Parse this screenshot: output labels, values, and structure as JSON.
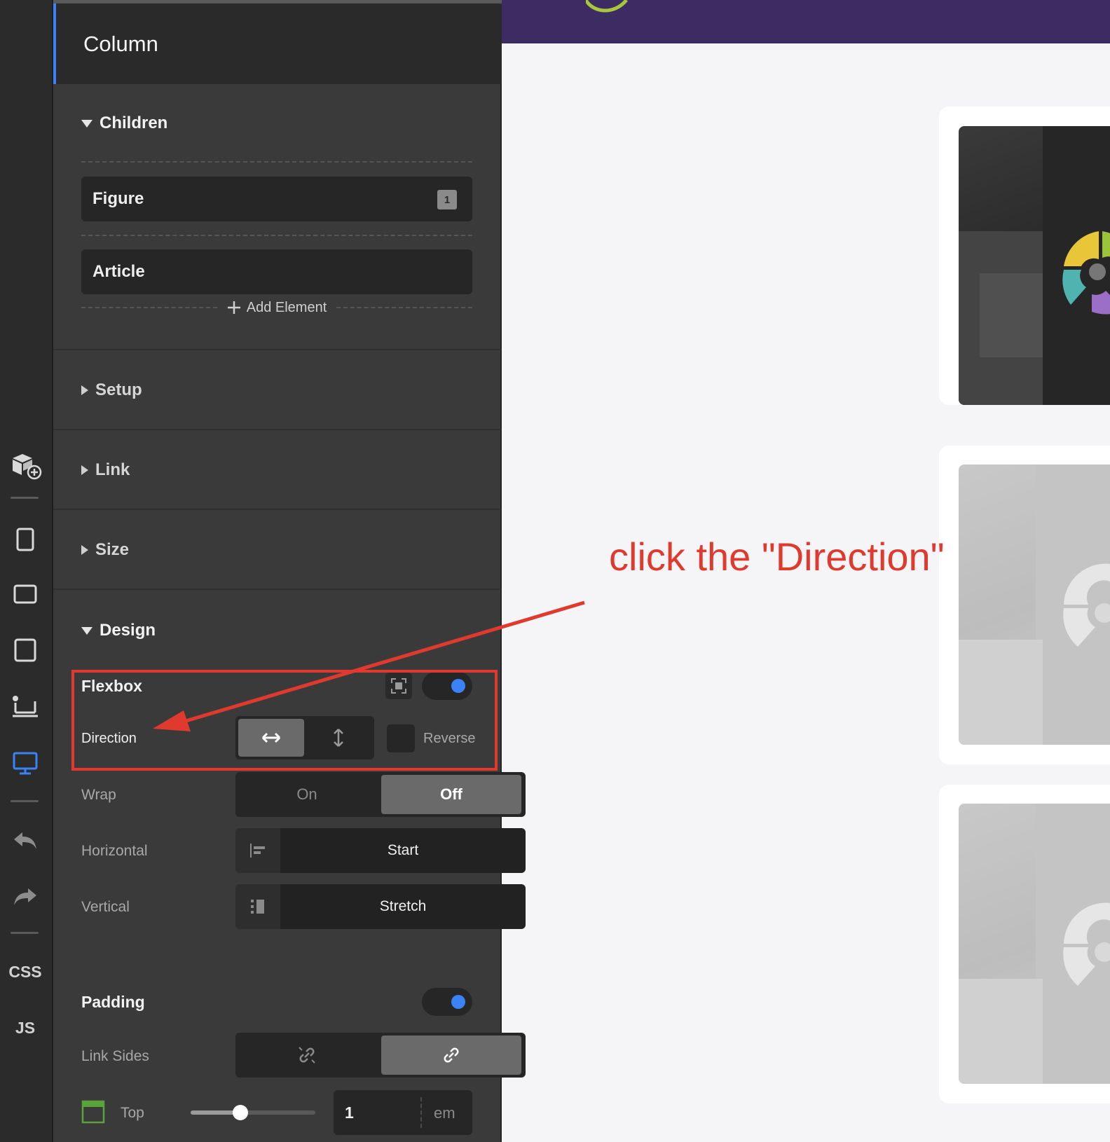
{
  "panel": {
    "title": "Column",
    "children_section": "Children",
    "children": [
      {
        "label": "Figure",
        "count": "1"
      },
      {
        "label": "Article"
      }
    ],
    "add_element": "Add Element",
    "sections": [
      "Setup",
      "Link",
      "Size"
    ],
    "design_section": "Design",
    "flexbox": {
      "title": "Flexbox",
      "enabled": true,
      "direction_label": "Direction",
      "reverse_label": "Reverse",
      "wrap_label": "Wrap",
      "wrap_options": [
        "On",
        "Off"
      ],
      "wrap_selected": "Off",
      "horizontal_label": "Horizontal",
      "horizontal_value": "Start",
      "vertical_label": "Vertical",
      "vertical_value": "Stretch"
    },
    "padding": {
      "title": "Padding",
      "enabled": true,
      "link_sides_label": "Link Sides",
      "top_label": "Top",
      "top_value": "1",
      "top_unit": "em",
      "top_slider_fraction": 0.4
    }
  },
  "toolbar": {
    "css_label": "CSS",
    "js_label": "JS",
    "icons": [
      "add-block-icon",
      "mobile-icon",
      "tablet-landscape-icon",
      "tablet-icon",
      "laptop-icon",
      "desktop-icon",
      "undo-icon",
      "redo-icon"
    ]
  },
  "annotation": {
    "text": "click the \"Direction\"",
    "color": "#e03a2f"
  },
  "colors": {
    "accent": "#3b82f6",
    "topbar": "#3c2c63",
    "panel": "#3a3a3a"
  }
}
